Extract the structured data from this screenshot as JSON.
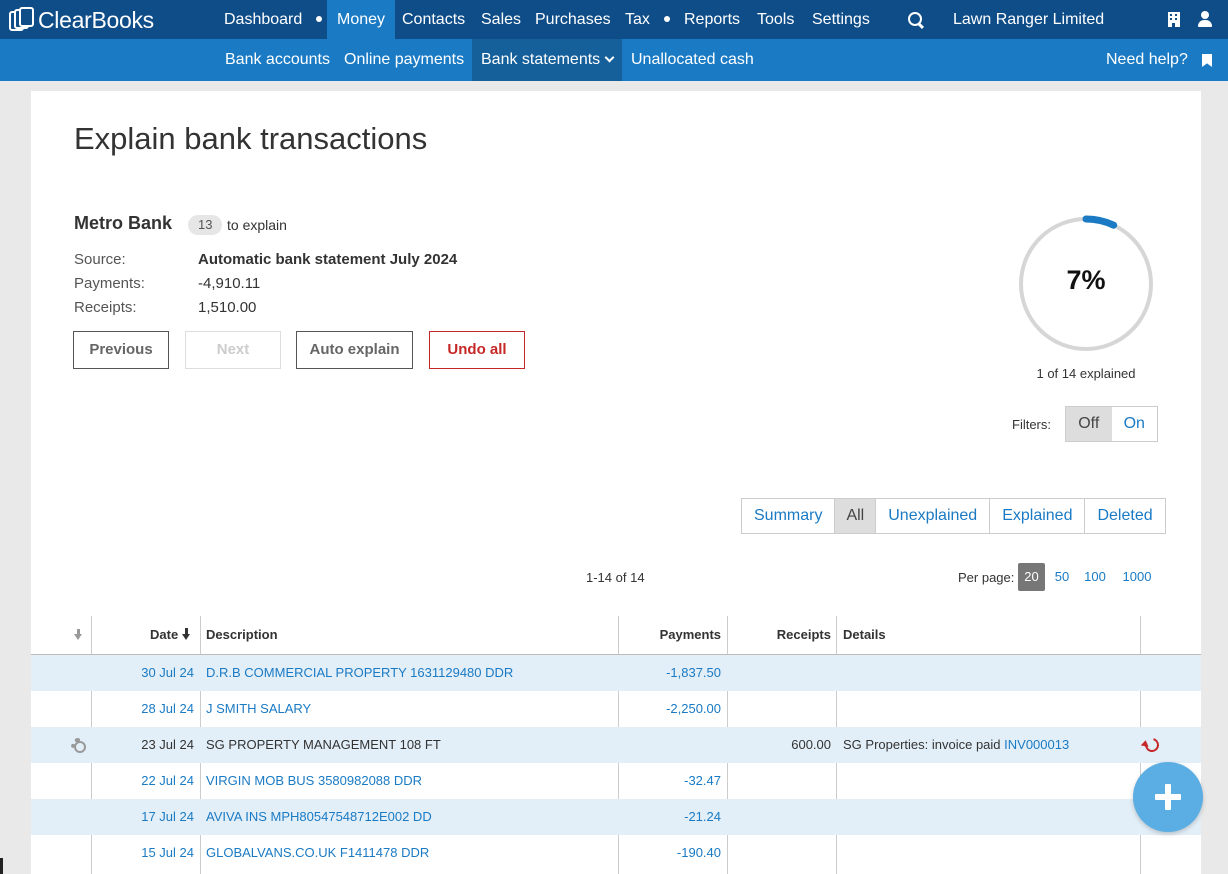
{
  "app": {
    "logo_text": "ClearBooks"
  },
  "topnav": {
    "items": [
      "Dashboard",
      "Money",
      "Contacts",
      "Sales",
      "Purchases",
      "Tax",
      "Reports",
      "Tools",
      "Settings"
    ],
    "active": "Money",
    "company": "Lawn Ranger Limited"
  },
  "subnav": {
    "items": [
      "Bank accounts",
      "Online payments",
      "Bank statements",
      "Unallocated cash"
    ],
    "active": "Bank statements",
    "help": "Need help?"
  },
  "page": {
    "title": "Explain bank transactions"
  },
  "bank": {
    "name": "Metro Bank",
    "unexplained_count": "13",
    "to_explain_text": "to explain",
    "source_label": "Source:",
    "source_value": "Automatic bank statement July 2024",
    "payments_label": "Payments:",
    "payments_value": "-4,910.11",
    "receipts_label": "Receipts:",
    "receipts_value": "1,510.00"
  },
  "actions": {
    "previous": "Previous",
    "next": "Next",
    "auto_explain": "Auto explain",
    "undo_all": "Undo all"
  },
  "progress": {
    "percent_text": "7%",
    "fraction": 0.07,
    "explained_text": "1 of 14 explained"
  },
  "filters": {
    "label": "Filters:",
    "off": "Off",
    "on": "On",
    "selected": "Off"
  },
  "view_tabs": {
    "items": [
      "Summary",
      "All",
      "Unexplained",
      "Explained",
      "Deleted"
    ],
    "selected": "All"
  },
  "pagination": {
    "range": "1-14 of 14",
    "per_page_label": "Per page:",
    "options": [
      "20",
      "50",
      "100",
      "1000"
    ],
    "selected": "20"
  },
  "table": {
    "headers": {
      "date": "Date",
      "description": "Description",
      "payments": "Payments",
      "receipts": "Receipts",
      "details": "Details"
    },
    "rows": [
      {
        "date": "30 Jul 24",
        "description": "D.R.B COMMERCIAL PROPERTY 1631129480 DDR",
        "payment": "-1,837.50",
        "receipt": "",
        "details": "",
        "invoice": "",
        "explained": false
      },
      {
        "date": "28 Jul 24",
        "description": "J SMITH SALARY",
        "payment": "-2,250.00",
        "receipt": "",
        "details": "",
        "invoice": "",
        "explained": false
      },
      {
        "date": "23 Jul 24",
        "description": "SG PROPERTY MANAGEMENT 108 FT",
        "payment": "",
        "receipt": "600.00",
        "details": "SG Properties: invoice paid",
        "invoice": "INV000013",
        "explained": true
      },
      {
        "date": "22 Jul 24",
        "description": "VIRGIN MOB BUS 3580982088 DDR",
        "payment": "-32.47",
        "receipt": "",
        "details": "",
        "invoice": "",
        "explained": false
      },
      {
        "date": "17 Jul 24",
        "description": "AVIVA INS MPH80547548712E002 DD",
        "payment": "-21.24",
        "receipt": "",
        "details": "",
        "invoice": "",
        "explained": false
      },
      {
        "date": "15 Jul 24",
        "description": "GLOBALVANS.CO.UK F1411478 DDR",
        "payment": "-190.40",
        "receipt": "",
        "details": "",
        "invoice": "",
        "explained": false
      }
    ]
  },
  "colors": {
    "topnav": "#0f4d88",
    "subnav": "#1a7ac4",
    "accent": "#1a7ac4",
    "danger": "#c62828",
    "row_shade": "#e3eff8"
  }
}
